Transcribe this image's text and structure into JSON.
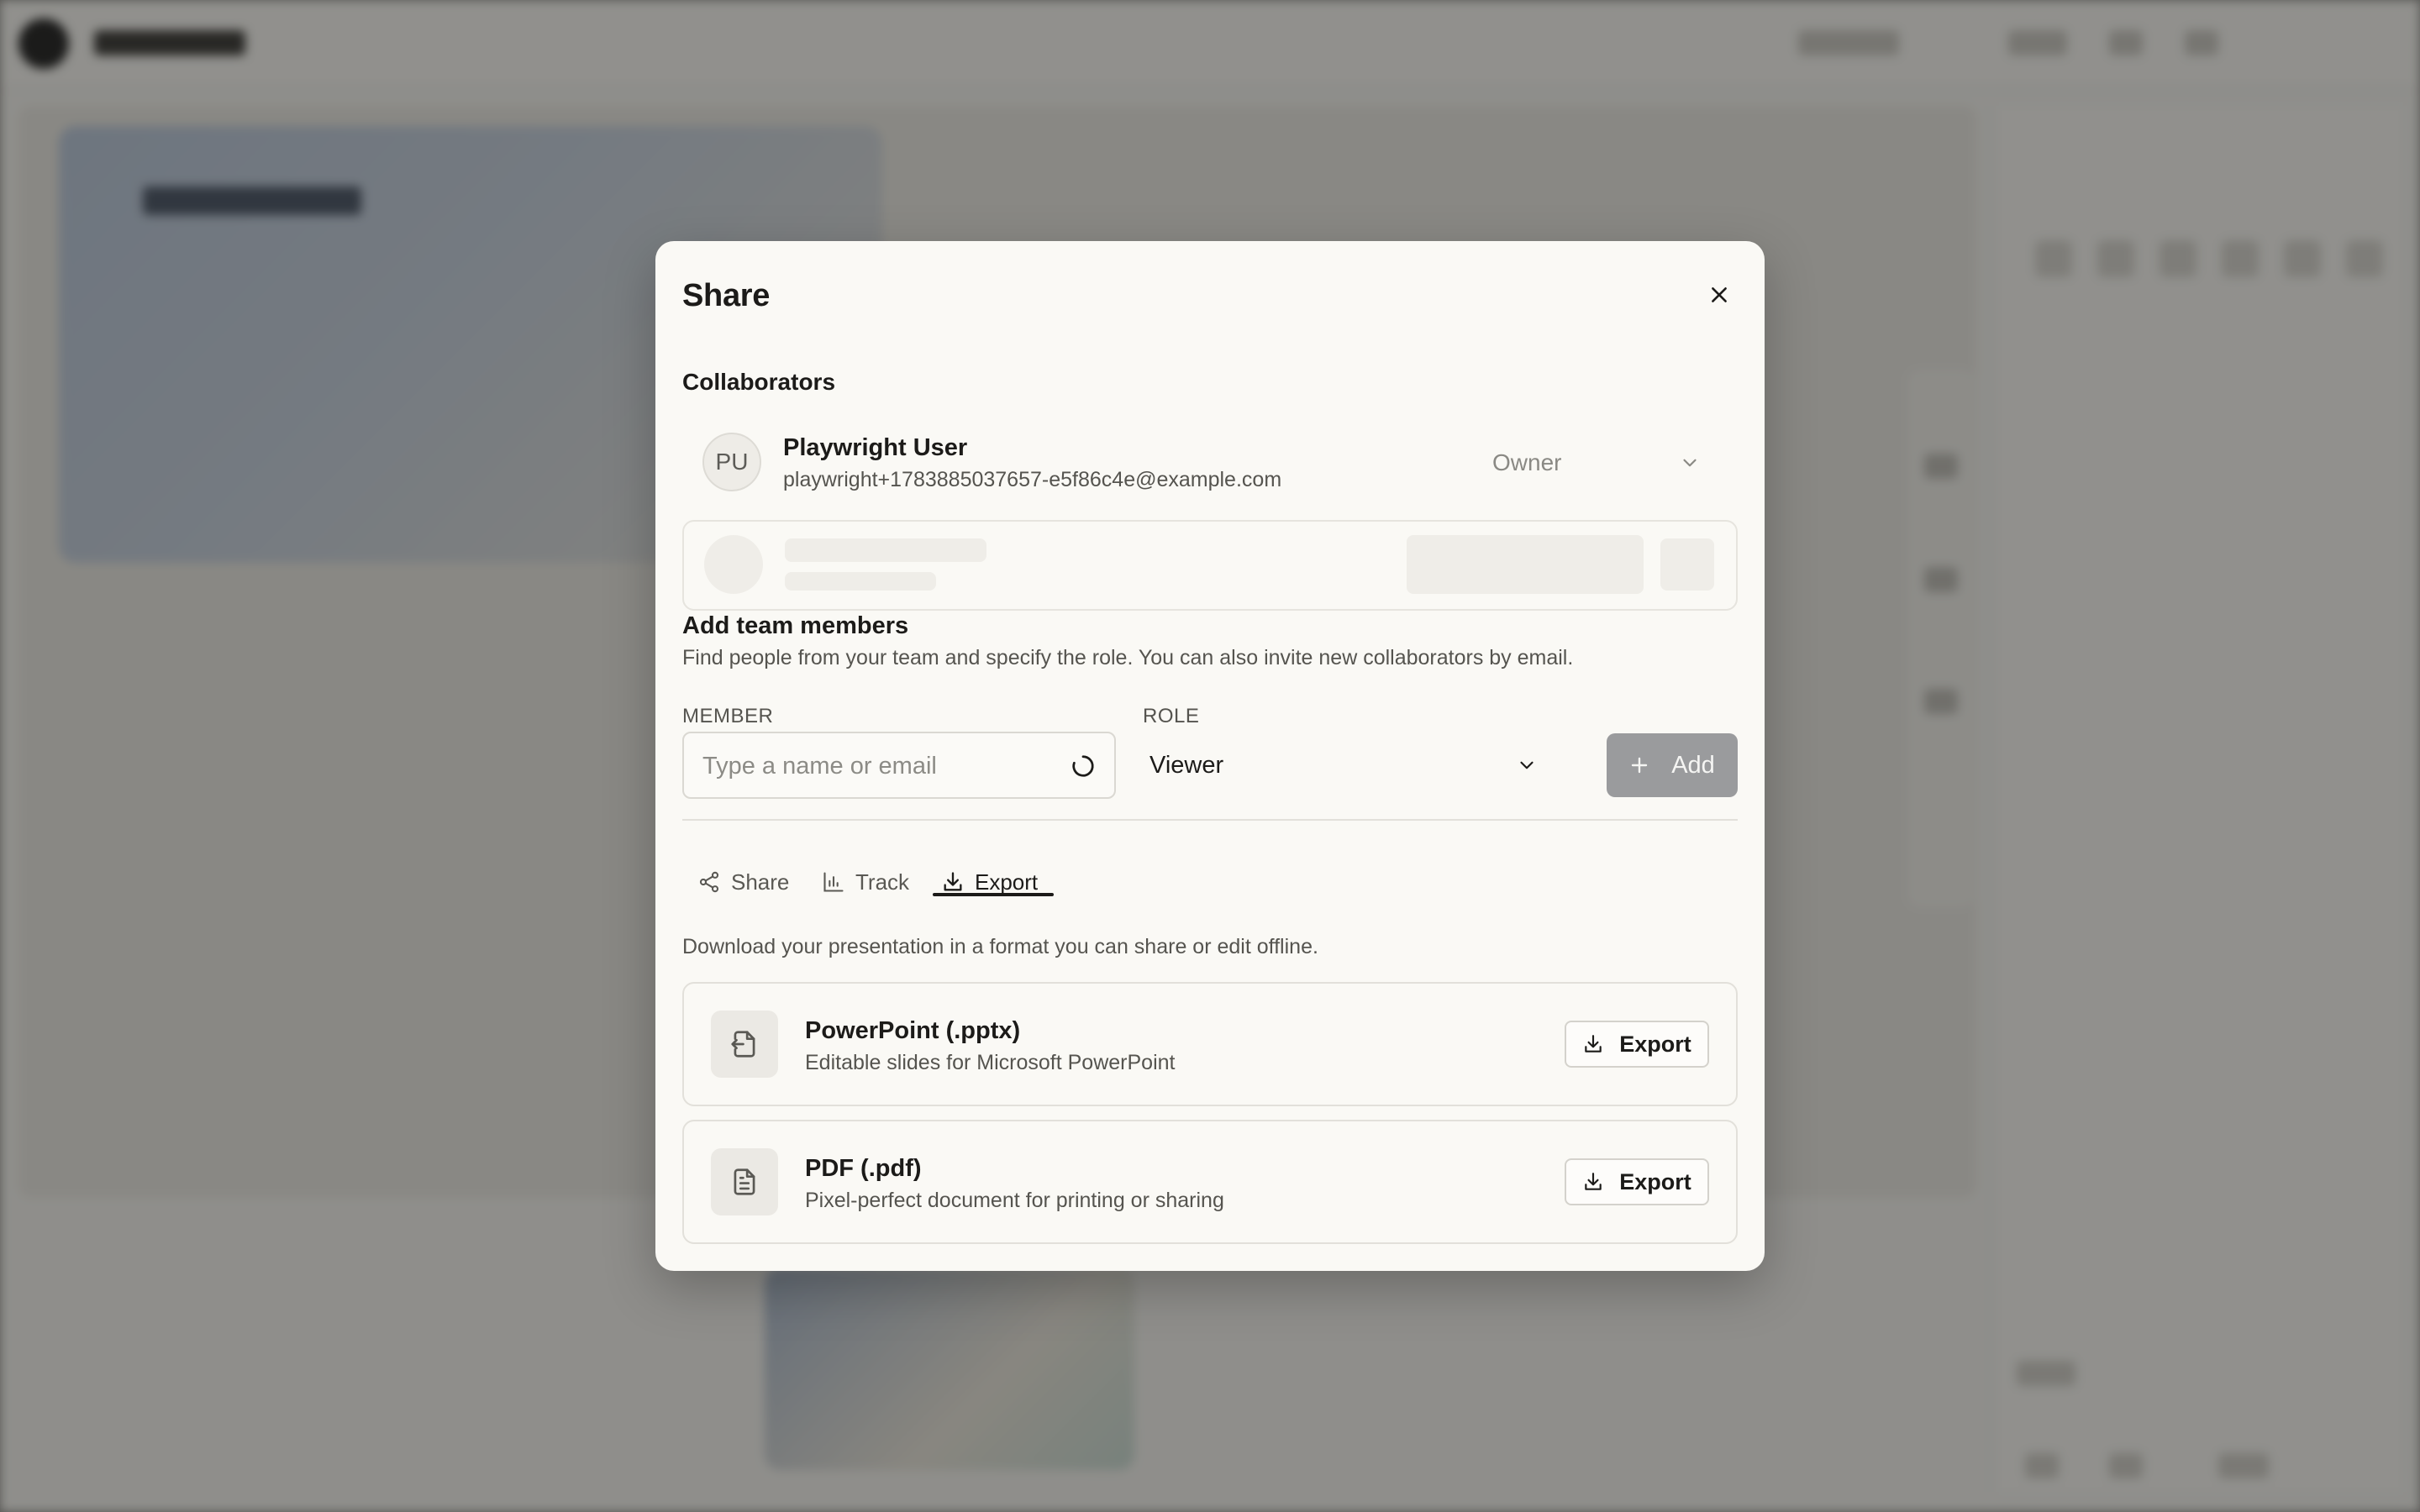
{
  "dialog": {
    "title": "Share",
    "close_icon": "close-icon"
  },
  "collaborators": {
    "heading": "Collaborators",
    "items": [
      {
        "initials": "PU",
        "name": "Playwright User",
        "email": "playwright+1783885037657-e5f86c4e@example.com",
        "role": "Owner"
      }
    ]
  },
  "add_members": {
    "title": "Add team members",
    "description": "Find people from your team and specify the role. You can also invite new collaborators by email.",
    "member_label": "MEMBER",
    "member_placeholder": "Type a name or email",
    "member_value": "",
    "role_label": "ROLE",
    "role_value": "Viewer",
    "add_label": "Add"
  },
  "tabs": [
    {
      "label": "Share",
      "icon": "share-icon",
      "active": false
    },
    {
      "label": "Track",
      "icon": "bar-chart-icon",
      "active": false
    },
    {
      "label": "Export",
      "icon": "download-icon",
      "active": true
    }
  ],
  "export": {
    "description": "Download your presentation in a format you can share or edit offline.",
    "formats": [
      {
        "title": "PowerPoint (.pptx)",
        "subtitle": "Editable slides for Microsoft PowerPoint",
        "icon": "file-import-icon",
        "button": "Export"
      },
      {
        "title": "PDF (.pdf)",
        "subtitle": "Pixel-perfect document for printing or sharing",
        "icon": "file-text-icon",
        "button": "Export"
      }
    ]
  },
  "colors": {
    "modal_bg": "#faf9f5",
    "add_button_disabled": "#9a9b9d",
    "overlay": "#8a8986"
  }
}
